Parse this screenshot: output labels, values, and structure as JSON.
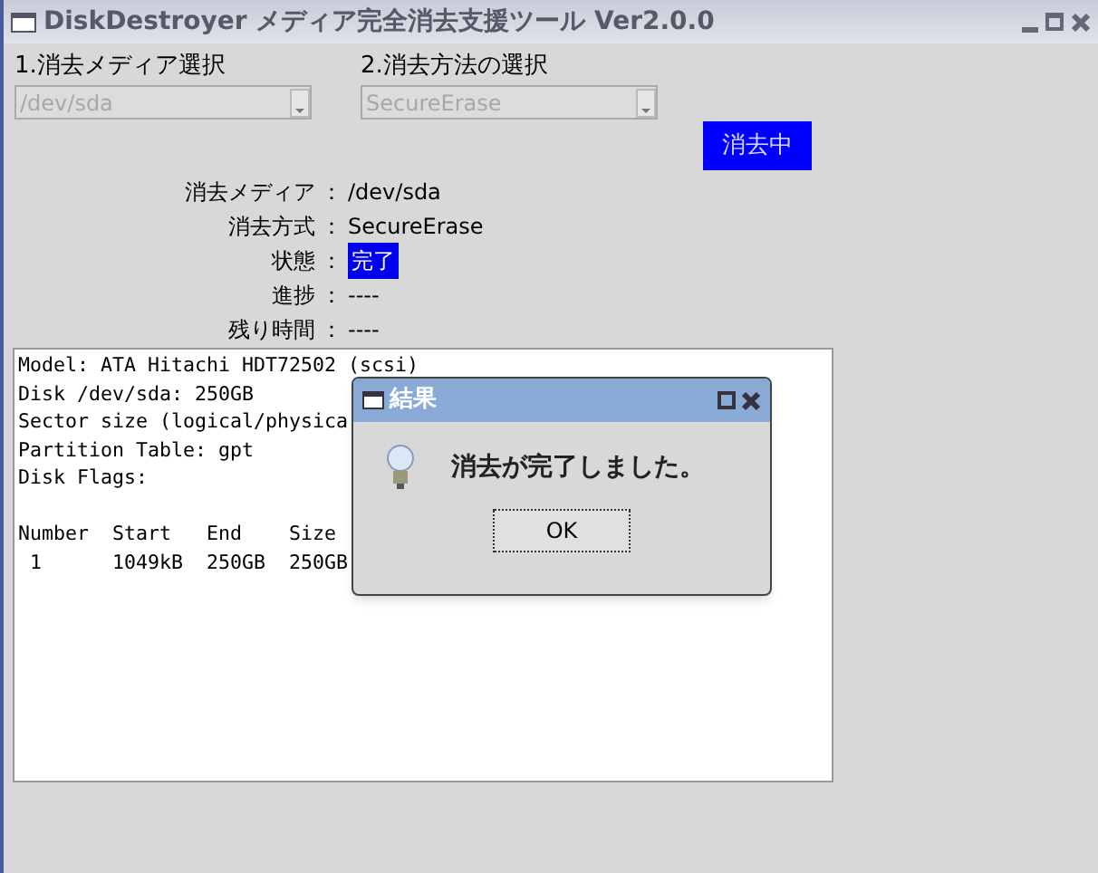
{
  "window": {
    "title": "DiskDestroyer メディア完全消去支援ツール Ver2.0.0"
  },
  "selectors": [
    {
      "label": "1.消去メディア選択",
      "value": "/dev/sda",
      "disabled": true
    },
    {
      "label": "2.消去方法の選択",
      "value": "SecureErase",
      "disabled": true
    }
  ],
  "action_button": {
    "label": "消去中"
  },
  "info_rows": [
    {
      "label": "消去メディア",
      "separator": "：",
      "value": "/dev/sda",
      "highlighted": false
    },
    {
      "label": "消去方式",
      "separator": "：",
      "value": "SecureErase",
      "highlighted": false
    },
    {
      "label": "状態",
      "separator": "：",
      "value": "完了",
      "highlighted": true
    },
    {
      "label": "進捗",
      "separator": "：",
      "value": "----",
      "highlighted": false
    },
    {
      "label": "残り時間",
      "separator": "：",
      "value": "----",
      "highlighted": false
    }
  ],
  "log_lines": [
    "Model: ATA Hitachi HDT72502 (scsi)",
    "Disk /dev/sda: 250GB",
    "Sector size (logical/physica",
    "Partition Table: gpt",
    "Disk Flags:"
  ],
  "partition_lines": [
    "Number  Start   End    Size",
    " 1      1049kB  250GB  250GB"
  ],
  "dialog": {
    "title": "結果",
    "message": "消去が完了しました。",
    "button": "OK"
  }
}
